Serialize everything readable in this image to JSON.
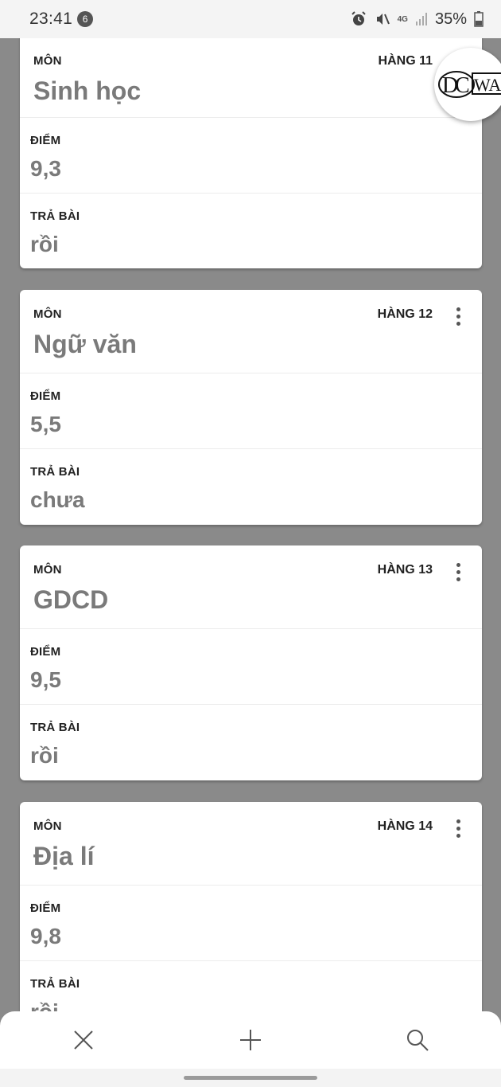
{
  "status": {
    "time": "23:41",
    "notification_count": "6",
    "network": "4G",
    "battery": "35%"
  },
  "cards": [
    {
      "subject_label": "MÔN",
      "row_label": "HÀNG 11",
      "subject": "Sinh học",
      "score_label": "ĐIỂM",
      "score": "9,3",
      "returned_label": "TRẢ BÀI",
      "returned": "rồi"
    },
    {
      "subject_label": "MÔN",
      "row_label": "HÀNG 12",
      "subject": "Ngữ văn",
      "score_label": "ĐIỂM",
      "score": "5,5",
      "returned_label": "TRẢ BÀI",
      "returned": "chưa"
    },
    {
      "subject_label": "MÔN",
      "row_label": "HÀNG 13",
      "subject": "GDCD",
      "score_label": "ĐIỂM",
      "score": "9,5",
      "returned_label": "TRẢ BÀI",
      "returned": "rồi"
    },
    {
      "subject_label": "MÔN",
      "row_label": "HÀNG 14",
      "subject": "Địa lí",
      "score_label": "ĐIỂM",
      "score": "9,8",
      "returned_label": "TRẢ BÀI",
      "returned": "rồi"
    }
  ],
  "logo": {
    "text": "DCWAC"
  },
  "bottom_bar": {
    "close_icon": "close-icon",
    "add_icon": "plus-icon",
    "search_icon": "search-icon"
  }
}
